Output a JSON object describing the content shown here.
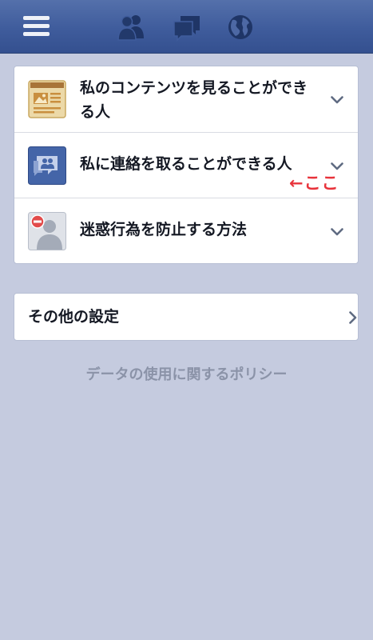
{
  "topbar": {
    "menu_icon": "hamburger-menu-icon",
    "icons": [
      "friend-requests-icon",
      "messages-icon",
      "notifications-globe-icon"
    ],
    "background": "#3f5c9c"
  },
  "privacy_shortcuts": {
    "items": [
      {
        "label": "私のコンテンツを見ることができる人",
        "icon": "content-news-icon"
      },
      {
        "label": "私に連絡を取ることができる人",
        "icon": "contact-chat-icon"
      },
      {
        "label": "迷惑行為を防止する方法",
        "icon": "block-user-icon"
      }
    ]
  },
  "annotation": {
    "text": "←ここ",
    "color": "#e8333b"
  },
  "other_settings": {
    "label": "その他の設定"
  },
  "footer": {
    "policy_link": "データの使用に関するポリシー"
  }
}
